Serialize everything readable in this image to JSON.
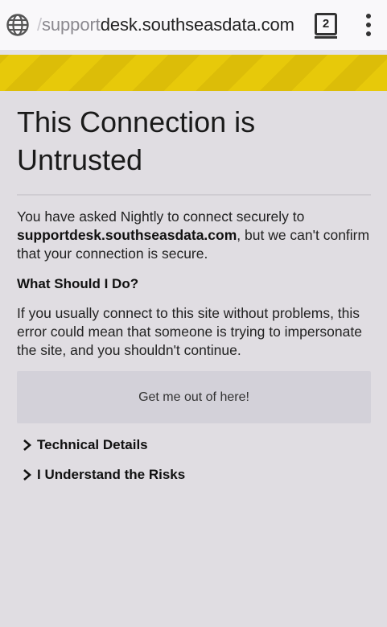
{
  "browser": {
    "url_slash": "/",
    "url_prefix": "support",
    "url_domain": "desk.southseasdata.com",
    "tab_count": "2",
    "icons": {
      "site_info": "globe-icon",
      "tabs": "tabs-icon",
      "menu": "more-vert-icon"
    }
  },
  "error_page": {
    "title": "This Connection is Untrusted",
    "intro_before": "You have asked Nightly to connect securely to ",
    "intro_host": "supportdesk.southseasdata.com",
    "intro_after": ", but we can't confirm that your connection is secure.",
    "what_heading": "What Should I Do?",
    "advice": "If you usually connect to this site without problems, this error could mean that someone is trying to impersonate the site, and you shouldn't continue.",
    "escape_button": "Get me out of here!",
    "technical_details": "Technical Details",
    "understand_risks": "I Understand the Risks"
  },
  "colors": {
    "stripe_primary": "#e7c90a",
    "stripe_secondary": "#dcbd08",
    "page_background": "#e0dde2",
    "button_background": "#d3d1d9"
  }
}
